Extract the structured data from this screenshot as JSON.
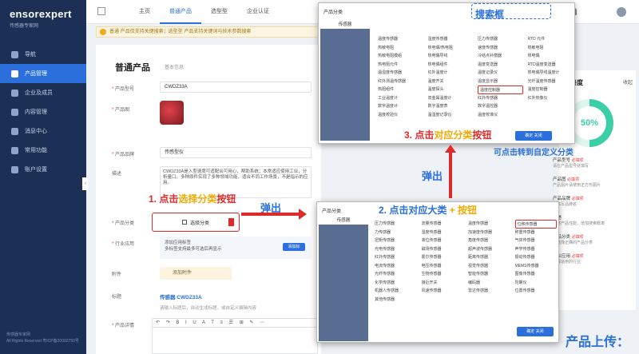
{
  "sidebar": {
    "brand": "ensorexpert",
    "brand_sub": "传感器专家网",
    "items": [
      {
        "label": "导航"
      },
      {
        "label": "产品管理",
        "active": true
      },
      {
        "label": "企业及成员"
      },
      {
        "label": "内容管理"
      },
      {
        "label": "消息中心"
      },
      {
        "label": "常用功能"
      },
      {
        "label": "账户设置"
      }
    ],
    "footer_line1": "传感器专家网",
    "footer_line2": "All Rights Reserved 粤ICP备20002750号"
  },
  "topbar": {
    "tabs": [
      "主页",
      "普通产品",
      "选型型",
      "企业认证"
    ],
    "active_tab": 1
  },
  "notice": "普通 产品仅支持关键搜索；选型型 产品支持关键词与技术参数搜索",
  "form": {
    "title": "普通产品",
    "subtitle": "基本信息",
    "name_label": "产品型号",
    "name_value": "CWDZ33A",
    "image_label": "产品图",
    "brand_label": "产品品牌",
    "brand_value": "传感型仪",
    "desc_label": "描述",
    "desc_value": "CWDZ33A是入型速度可适配合可用心，帮助系统；本常适应使用工业，分析量口，多种原件实现了多种领域功能，适合不同工作场景，不是指示的应用。",
    "category_label": "产品分类",
    "category_button": "选择分类",
    "industry_label": "行业应用",
    "industry_line1": "添加应用标签",
    "industry_line2": "多标签支持最多可选后再显示",
    "industry_btn": "添加标",
    "attach_label": "附件",
    "attach_button": "添加附件",
    "title_label": "标题",
    "title_value": "传感器 CWDZ33A",
    "title_hint": "请输入标题后，自动生成标题，或自定义编辑内容",
    "detail_label": "产品详情",
    "toolbar_glyphs": "↶ ↷ B I U A T ≡ ☰ ⊞ ✎ ⋯"
  },
  "popup_top": {
    "title": "产品分类",
    "left_header": "传感器",
    "search_label": "搜索框",
    "cells": [
      "温度传感器",
      "湿度传感器",
      "压力传感器",
      "RTD 元件",
      "热敏电阻",
      "热电偶/热电阻",
      "速度传感器",
      "热敏电阻",
      "热敏电阻模组",
      "热电偶导线",
      "冷结点补偿器",
      "热电偶",
      "热电阻元件",
      "热电偶组件",
      "温度变送器",
      "RTD温度变送器",
      "温湿度传感器",
      "红外温度计",
      "温度记录仪",
      "热电偶导线温度计",
      "红外测温传感器",
      "温度开关",
      "温度显示器",
      "光纤温度传感器",
      "热阻组件",
      "温度探头",
      "温度控制器",
      "温度控制器",
      "工业温度计",
      "双金属温度计",
      "红外传感器",
      "红外热像仪",
      "数字温度计",
      "数字温度表",
      "数字温控器",
      "",
      "温度校验仪",
      "温湿度记录仪",
      "温度校准仪",
      ""
    ],
    "highlight_index": 26,
    "ok_label": "确定  关闭"
  },
  "popup_bottom": {
    "title": "产品分类",
    "left_header": "传感器",
    "cells": [
      "压力传感器",
      "流量传感器",
      "温度传感器",
      "位移传感器",
      "力传感器",
      "湿度传感器",
      "加速度传感器",
      "称重传感器",
      "扭矩传感器",
      "液位传感器",
      "角度传感器",
      "气体传感器",
      "光电传感器",
      "磁场传感器",
      "超声波传感器",
      "声学传感器",
      "红外传感器",
      "霍尔传感器",
      "距离传感器",
      "振动传感器",
      "电流传感器",
      "电压传感器",
      "视觉传感器",
      "MEMS传感器",
      "光纤传感器",
      "生物传感器",
      "智能传感器",
      "图像传感器",
      "化学传感器",
      "接近开关",
      "编码器",
      "陀螺仪",
      "机器人传感器",
      "风速传感器",
      "雷达传感器",
      "位置传感器",
      "其他传感器",
      "",
      "",
      ""
    ],
    "highlight_index": 3,
    "ok_label": "确定  关闭"
  },
  "annotations": {
    "step1_prefix": "1. 点击",
    "step1_highlight": "选择分类",
    "step1_suffix": "按钮",
    "popup1": "弹出",
    "step2": "2. 点击对应大类",
    "step2_plus": "+ 按钮",
    "popup2": "弹出",
    "step3_prefix": "3. 点击",
    "step3_highlight": "对应分类",
    "step3_suffix": "按钮",
    "custom_note": "可点击转到自定义分类",
    "upload_title": "产品上传："
  },
  "right_panel": {
    "title": "完善度",
    "option": "收起",
    "percent": "50%",
    "items": [
      {
        "name": "产品型号",
        "status": "必填项",
        "sub": "请在产品型号处填写"
      },
      {
        "name": "产品图",
        "status": "必填项",
        "sub": "产品图片请使用正方形图片"
      },
      {
        "name": "产品品牌",
        "status": "必填项",
        "sub": "请填写品牌名"
      },
      {
        "name": "描述",
        "status": "",
        "sub": "描述产品性能，增加搜索概率"
      },
      {
        "name": "产品分类",
        "status": "必填项",
        "sub": "请选择正确的产品分类"
      },
      {
        "name": "行业应用",
        "status": "必填项",
        "sub": "选择适用的行业"
      }
    ]
  },
  "colors": {
    "sidebar_bg": "#1c2f55",
    "accent": "#2a6fdb",
    "annotation_red": "#e02a2a",
    "annotation_gold": "#f2a900"
  }
}
